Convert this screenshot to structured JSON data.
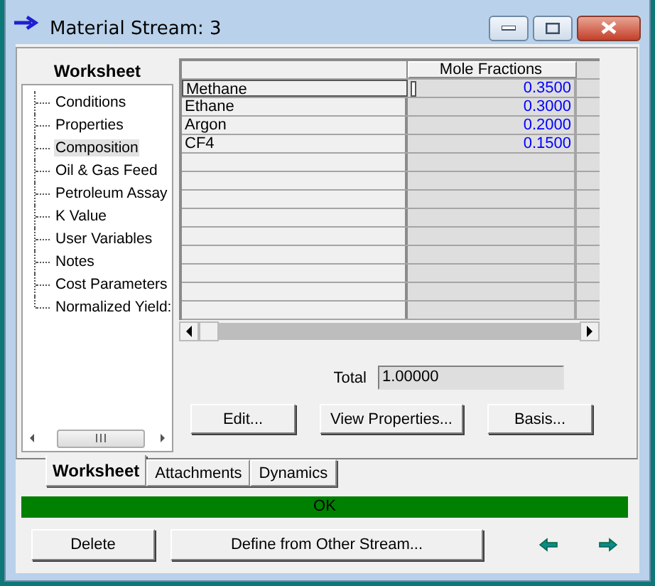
{
  "window": {
    "title": "Material Stream: 3"
  },
  "nav": {
    "header": "Worksheet",
    "items": [
      {
        "label": "Conditions",
        "selected": false
      },
      {
        "label": "Properties",
        "selected": false
      },
      {
        "label": "Composition",
        "selected": true
      },
      {
        "label": "Oil & Gas Feed",
        "selected": false
      },
      {
        "label": "Petroleum Assay",
        "selected": false
      },
      {
        "label": "K Value",
        "selected": false
      },
      {
        "label": "User Variables",
        "selected": false
      },
      {
        "label": "Notes",
        "selected": false
      },
      {
        "label": "Cost Parameters",
        "selected": false
      },
      {
        "label": "Normalized Yield:",
        "selected": false
      }
    ]
  },
  "grid": {
    "column_header": "Mole Fractions",
    "rows": [
      {
        "name": "Methane",
        "value": "0.3500"
      },
      {
        "name": "Ethane",
        "value": "0.3000"
      },
      {
        "name": "Argon",
        "value": "0.2000"
      },
      {
        "name": "CF4",
        "value": "0.1500"
      }
    ]
  },
  "total": {
    "label": "Total",
    "value": "1.00000"
  },
  "buttons": [
    "Edit...",
    "View Properties...",
    "Basis..."
  ],
  "tabs": [
    {
      "label": "Worksheet",
      "selected": true
    },
    {
      "label": "Attachments",
      "selected": false
    },
    {
      "label": "Dynamics",
      "selected": false
    }
  ],
  "status": "OK",
  "footer_buttons": [
    "Delete",
    "Define from Other Stream..."
  ]
}
